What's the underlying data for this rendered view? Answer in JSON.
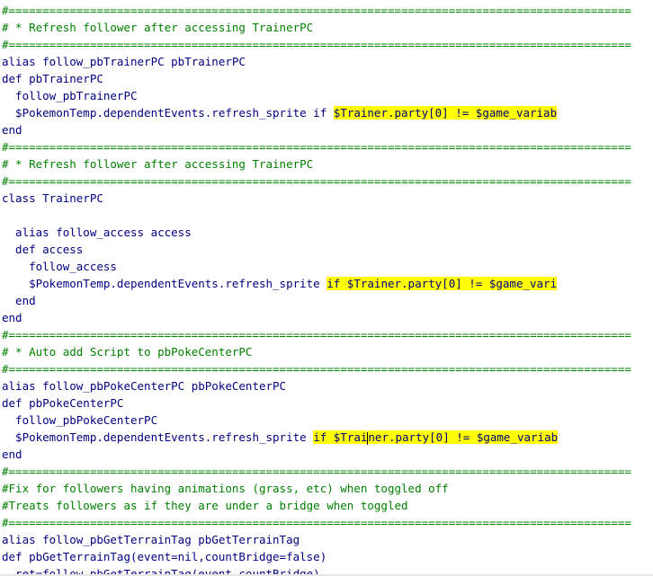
{
  "lines": [
    {
      "type": "comment",
      "text": "#============================================================================================"
    },
    {
      "type": "comment",
      "text": "# * Refresh follower after accessing TrainerPC"
    },
    {
      "type": "comment",
      "text": "#============================================================================================"
    },
    {
      "type": "code",
      "text": "alias follow_pbTrainerPC pbTrainerPC"
    },
    {
      "type": "code",
      "text": "def pbTrainerPC"
    },
    {
      "type": "code",
      "text": "  follow_pbTrainerPC"
    },
    {
      "type": "code_hl",
      "before": "  $PokemonTemp.dependentEvents.refresh_sprite if ",
      "hl": "$Trainer.party[0] != $game_variab"
    },
    {
      "type": "code",
      "text": "end"
    },
    {
      "type": "comment",
      "text": "#============================================================================================"
    },
    {
      "type": "comment",
      "text": "# * Refresh follower after accessing TrainerPC"
    },
    {
      "type": "comment",
      "text": "#============================================================================================"
    },
    {
      "type": "code",
      "text": "class TrainerPC"
    },
    {
      "type": "blank",
      "text": ""
    },
    {
      "type": "code",
      "text": "  alias follow_access access"
    },
    {
      "type": "code",
      "text": "  def access"
    },
    {
      "type": "code",
      "text": "    follow_access"
    },
    {
      "type": "code_hl",
      "before": "    $PokemonTemp.dependentEvents.refresh_sprite ",
      "hl": "if $Trainer.party[0] != $game_vari"
    },
    {
      "type": "code",
      "text": "  end"
    },
    {
      "type": "code",
      "text": "end"
    },
    {
      "type": "comment",
      "text": "#============================================================================================"
    },
    {
      "type": "comment",
      "text": "# * Auto add Script to pbPokeCenterPC"
    },
    {
      "type": "comment",
      "text": "#============================================================================================"
    },
    {
      "type": "code",
      "text": "alias follow_pbPokeCenterPC pbPokeCenterPC"
    },
    {
      "type": "code",
      "text": "def pbPokeCenterPC"
    },
    {
      "type": "code",
      "text": "  follow_pbPokeCenterPC"
    },
    {
      "type": "code_hl_caret",
      "before": "  $PokemonTemp.dependentEvents.refresh_sprite ",
      "hl_a": "if $Trai",
      "hl_b": "ner.party[0] != $game_variab"
    },
    {
      "type": "code",
      "text": "end"
    },
    {
      "type": "comment",
      "text": "#============================================================================================"
    },
    {
      "type": "comment",
      "text": "#Fix for followers having animations (grass, etc) when toggled off"
    },
    {
      "type": "comment",
      "text": "#Treats followers as if they are under a bridge when toggled"
    },
    {
      "type": "comment",
      "text": "#============================================================================================"
    },
    {
      "type": "code",
      "text": "alias follow_pbGetTerrainTag pbGetTerrainTag"
    },
    {
      "type": "code",
      "text": "def pbGetTerrainTag(event=nil,countBridge=false)"
    },
    {
      "type": "code",
      "text": "  ret=follow_pbGetTerrainTag(event,countBridge)"
    }
  ],
  "colors": {
    "comment": "#008000",
    "code": "#000080",
    "highlight": "#ffff00"
  }
}
